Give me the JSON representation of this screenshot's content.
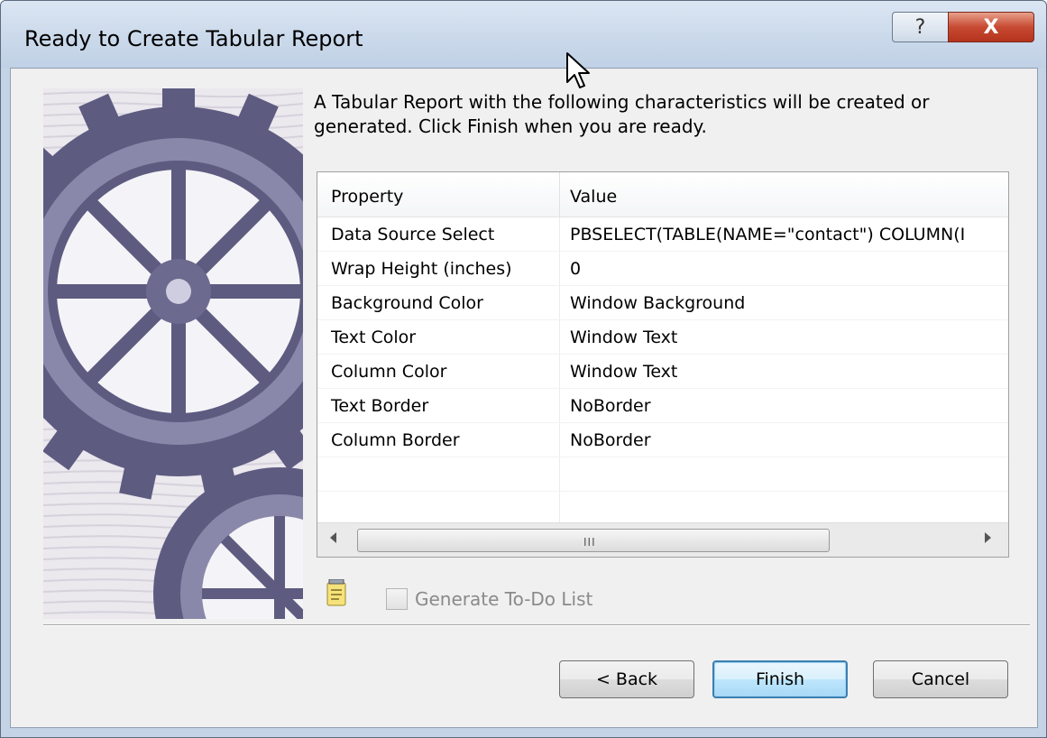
{
  "window": {
    "title": "Ready to Create Tabular Report",
    "help_label": "?",
    "close_label": "X"
  },
  "intro_text": "A Tabular Report with the following characteristics will be created or generated.  Click Finish when you are ready.",
  "grid": {
    "headers": [
      "Property",
      "Value"
    ],
    "rows": [
      [
        "Data Source Select",
        "PBSELECT(TABLE(NAME=\"contact\") COLUMN(I"
      ],
      [
        "Wrap Height (inches)",
        "0"
      ],
      [
        "Background Color",
        "Window Background"
      ],
      [
        "Text Color",
        "Window Text"
      ],
      [
        "Column Color",
        "Window Text"
      ],
      [
        "Text Border",
        "NoBorder"
      ],
      [
        "Column Border",
        "NoBorder"
      ]
    ],
    "scroll_grip": "III"
  },
  "todo": {
    "label": "Generate To-Do List",
    "checked": false,
    "enabled": false
  },
  "buttons": {
    "back": "< Back",
    "finish": "Finish",
    "cancel": "Cancel"
  }
}
